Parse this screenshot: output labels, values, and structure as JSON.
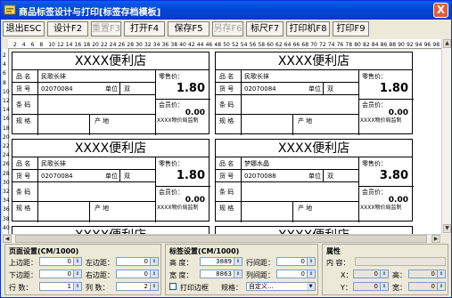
{
  "window": {
    "title": "商品标签设计与打印[标签存档模板]",
    "close_label": "X"
  },
  "toolbar": [
    {
      "label": "退出ESC",
      "disabled": false
    },
    {
      "label": "设计F2",
      "disabled": false
    },
    {
      "label": "重置F3",
      "disabled": true
    },
    {
      "label": "打开F4",
      "disabled": false
    },
    {
      "label": "保存F5",
      "disabled": false
    },
    {
      "label": "另存F6",
      "disabled": true
    },
    {
      "label": "标尺F7",
      "disabled": false
    },
    {
      "label": "打印机F8",
      "disabled": false
    },
    {
      "label": "打印F9",
      "disabled": false
    }
  ],
  "ruler": {
    "top": [
      "2",
      "4",
      "6",
      "8",
      "10",
      "12",
      "14",
      "16",
      "18",
      "20",
      "22",
      "24",
      "26",
      "28",
      "30",
      "32",
      "34",
      "36",
      "38",
      "40",
      "42",
      "44",
      "46",
      "48",
      "50",
      "52",
      "54",
      "56",
      "58",
      "60",
      "62",
      "64",
      "66",
      "68",
      "70",
      "72",
      "74",
      "76",
      "78",
      "80",
      "82",
      "84",
      "86",
      "88",
      "90",
      "92",
      "94",
      "96",
      "98"
    ],
    "left": [
      "2",
      "4",
      "6",
      "8",
      "10",
      "12",
      "14",
      "16",
      "18",
      "20",
      "22",
      "24",
      "26",
      "28",
      "30",
      "32",
      "34",
      "36",
      "38",
      "40"
    ]
  },
  "label_fields": {
    "name": "品  名",
    "code": "货  号",
    "unit": "单位",
    "barcode": "条  码",
    "spec": "规  格",
    "origin": "产  地",
    "price": "零售价：",
    "member_price": "会员价：",
    "authority": "XXXX物价局监制"
  },
  "labels": [
    {
      "shop": "XXXX便利店",
      "name": "民歌长袜",
      "code": "02070084",
      "unit": "双",
      "price": "1.80",
      "member_price": "0.00"
    },
    {
      "shop": "XXXX便利店",
      "name": "民歌长袜",
      "code": "02070084",
      "unit": "双",
      "price": "1.80",
      "member_price": "0.00"
    },
    {
      "shop": "XXXX便利店",
      "name": "民歌长袜",
      "code": "02070084",
      "unit": "双",
      "price": "1.80",
      "member_price": "0.00"
    },
    {
      "shop": "XXXX便利店",
      "name": "梦娜水晶",
      "code": "02070088",
      "unit": "双",
      "price": "3.80",
      "member_price": "0.00"
    },
    {
      "shop": "XXXX便利店",
      "name": "",
      "code": "",
      "unit": "",
      "price": "",
      "member_price": ""
    },
    {
      "shop": "XXXX便利店",
      "name": "",
      "code": "",
      "unit": "",
      "price": "",
      "member_price": ""
    }
  ],
  "page_settings": {
    "title": "页面设置(CM/1000)",
    "top_margin_label": "上边距：",
    "top_margin": "0",
    "left_margin_label": "左边距：",
    "left_margin": "0",
    "bottom_margin_label": "下边距：",
    "bottom_margin": "0",
    "right_margin_label": "右边距：",
    "right_margin": "0",
    "rows_label": "行  数：",
    "rows": "1",
    "cols_label": "列  数：",
    "cols": "2"
  },
  "label_settings": {
    "title": "标签设置(CM/1000)",
    "height_label": "高  度：",
    "height": "3889",
    "row_gap_label": "行间距：",
    "row_gap": "0",
    "width_label": "宽  度：",
    "width": "8863",
    "col_gap_label": "列间距：",
    "col_gap": "0",
    "print_border_label": "打印边框",
    "spec_label": "规格：",
    "spec_value": "自定义..."
  },
  "properties": {
    "title": "属性",
    "content_label": "内  容：",
    "x_label": "X：",
    "x": "0",
    "height_label": "高：",
    "height": "0",
    "y_label": "Y：",
    "y": "0",
    "width_label": "宽：",
    "width": "0"
  }
}
